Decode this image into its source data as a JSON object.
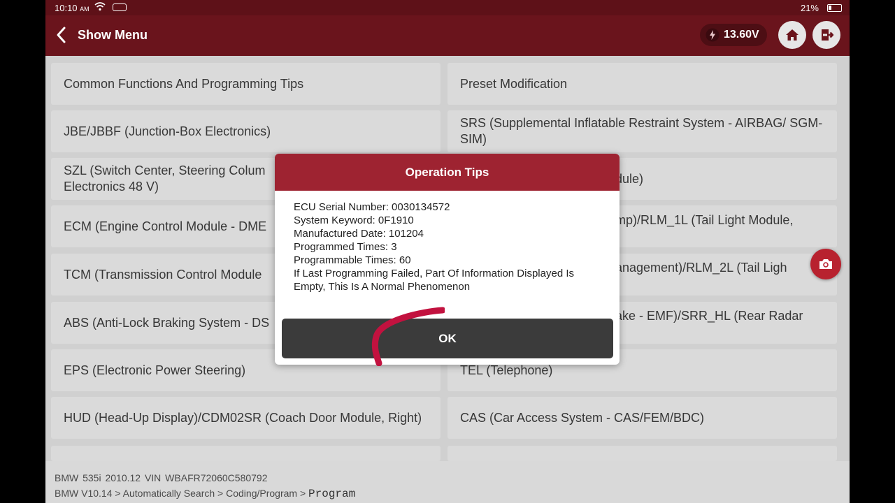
{
  "status_bar": {
    "time": "10:10",
    "ampm": "AM",
    "battery": "21%"
  },
  "header": {
    "title": "Show Menu",
    "voltage": "13.60V"
  },
  "menu_items": [
    "Common Functions And Programming Tips",
    "Preset Modification",
    "JBE/JBBF (Junction-Box Electronics)",
    "SRS (Supplemental Inflatable Restraint System - AIRBAG/ SGM-SIM)",
    "SZL (Switch Center, Steering Colum",
    "Electronics 48 V)",
    "dule)",
    "ECM (Engine Control Module - DME",
    "mp)/RLM_1L (Tail Light Module,",
    "TCM (Transmission Control Module",
    "anagement)/RLM_2L (Tail Ligh",
    "ABS (Anti-Lock Braking System - DS",
    "ake - EMF)/SRR_HL (Rear Radar",
    "EPS (Electronic Power Steering)",
    "TEL (Telephone)",
    "HUD (Head-Up Display)/CDM02SR (Coach Door Module, Right)",
    "CAS (Car Access System - CAS/FEM/BDC)"
  ],
  "footer": {
    "vehicle": "BMW 535i 2010.12 VIN WBAFR72060C580792",
    "breadcrumb": "BMW V10.14 > Automatically Search > Coding/Program >",
    "breadcrumb_current": "Program"
  },
  "dialog": {
    "title": "Operation Tips",
    "lines": [
      "ECU Serial Number: 0030134572",
      "System Keyword: 0F1910",
      "Manufactured Date: 101204",
      "Programmed Times: 3",
      "Programmable Times: 60",
      "If Last Programming Failed, Part Of Information Displayed Is Empty, This Is A Normal Phenomenon"
    ],
    "ok_label": "OK"
  },
  "colors": {
    "appbar": "#6a141c",
    "dialog_header": "#9e2331",
    "ok_button": "#3b3b3b",
    "accent": "#b8222f"
  }
}
